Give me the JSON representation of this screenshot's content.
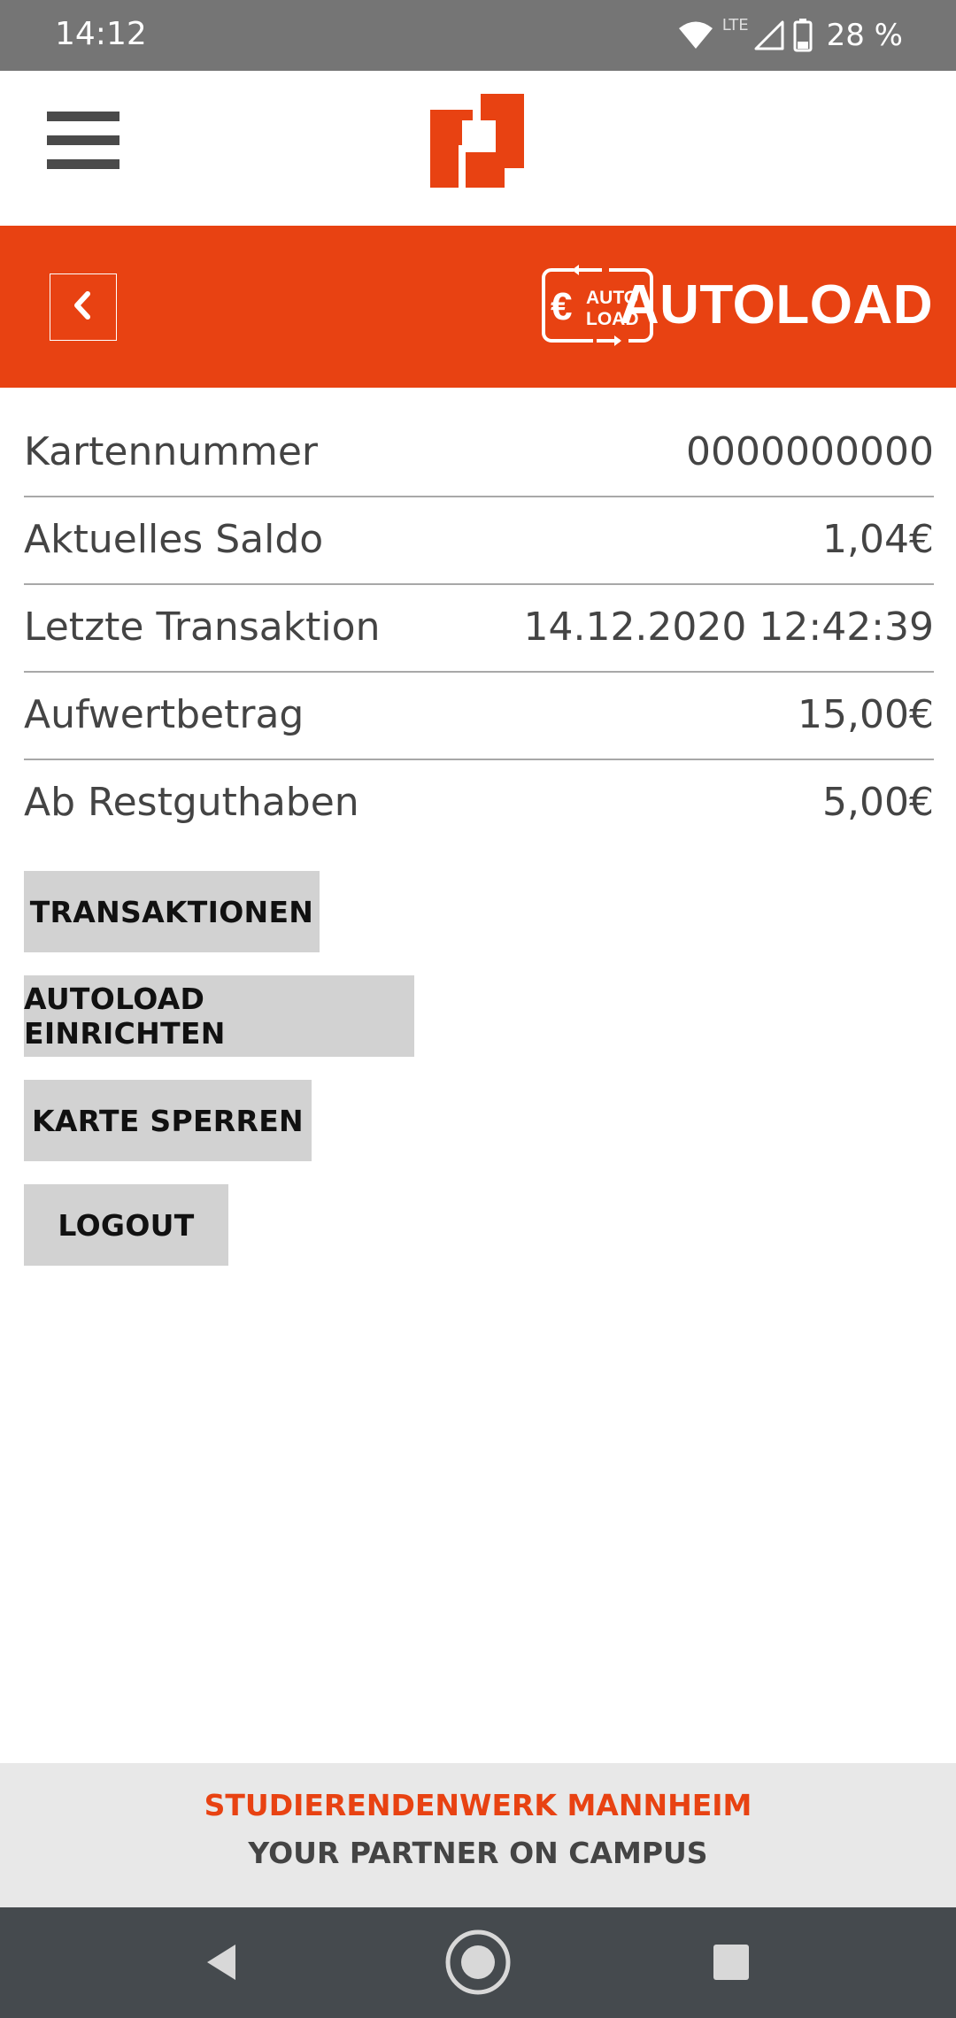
{
  "status_bar": {
    "time": "14:12",
    "network_label": "LTE",
    "battery": "28 %",
    "icons": [
      "wifi-icon",
      "signal-icon",
      "battery-icon"
    ]
  },
  "header": {
    "menu_icon": "hamburger-menu-icon",
    "logo_icon": "studierendenwerk-logo-icon"
  },
  "title_bar": {
    "back_icon": "chevron-left-icon",
    "badge_symbol": "€",
    "badge_line1": "AUTO",
    "badge_line2": "LOAD",
    "title": "AUTOLOAD"
  },
  "info_rows": [
    {
      "label": "Kartennummer",
      "value": "0000000000"
    },
    {
      "label": "Aktuelles Saldo",
      "value": "1,04€"
    },
    {
      "label": "Letzte Transaktion",
      "value": "14.12.2020 12:42:39"
    },
    {
      "label": "Aufwertbetrag",
      "value": "15,00€"
    },
    {
      "label": "Ab Restguthaben",
      "value": "5,00€"
    }
  ],
  "buttons": {
    "transactions": "TRANSAKTIONEN",
    "autoload_setup": "AUTOLOAD EINRICHTEN",
    "block_card": "KARTE SPERREN",
    "logout": "LOGOUT"
  },
  "footer": {
    "title": "STUDIERENDENWERK MANNHEIM",
    "subtitle": "YOUR PARTNER ON CAMPUS"
  },
  "nav_bar": {
    "icons": [
      "back-triangle-icon",
      "home-circle-icon",
      "recents-square-icon"
    ]
  },
  "colors": {
    "accent": "#e84212",
    "status_bar": "#757575",
    "nav_bar": "#454a4e",
    "button_bg": "#d2d2d2",
    "footer_bg": "#e8e8e8"
  }
}
